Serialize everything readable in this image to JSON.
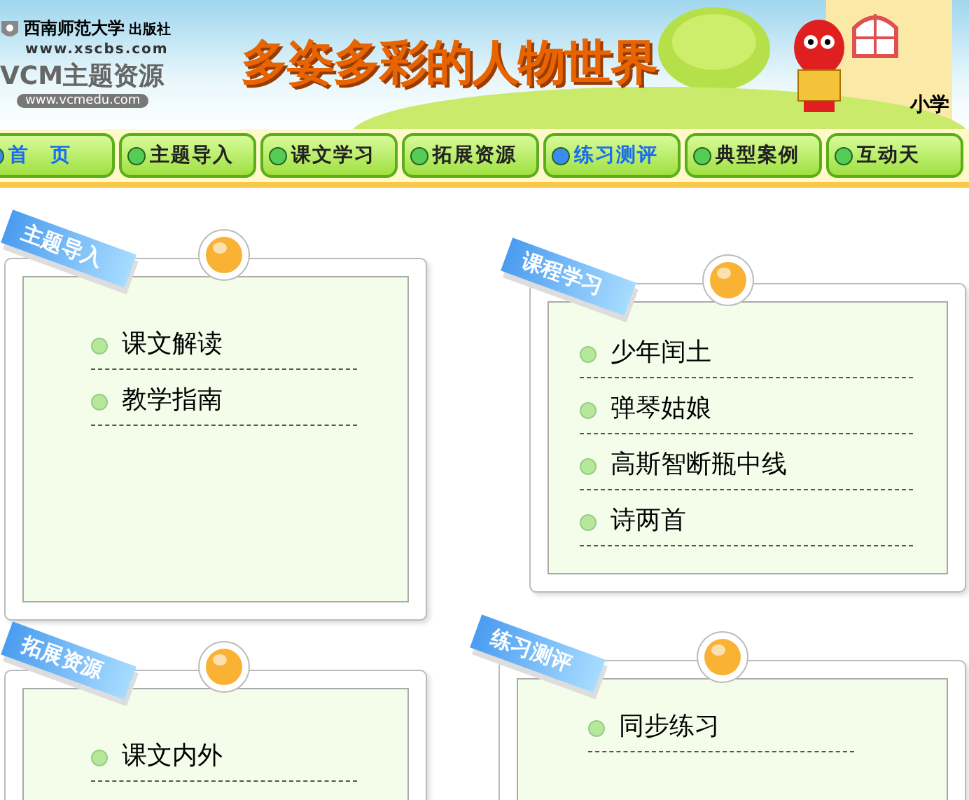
{
  "header": {
    "publisher": "西南师范大学",
    "publisher_suffix": "出版社",
    "publisher_url": "www.xscbs.com",
    "brand": "VCM主题资源",
    "brand_url": "www.vcmedu.com",
    "title": "多姿多彩的人物世界",
    "corner_label": "小学"
  },
  "nav": [
    {
      "label": "首　页",
      "selected": true
    },
    {
      "label": "主题导入",
      "selected": false
    },
    {
      "label": "课文学习",
      "selected": false
    },
    {
      "label": "拓展资源",
      "selected": false
    },
    {
      "label": "练习测评",
      "selected": true
    },
    {
      "label": "典型案例",
      "selected": false
    },
    {
      "label": "互动天",
      "selected": false
    }
  ],
  "cards": [
    {
      "ribbon": "主题导入",
      "items": [
        "课文解读",
        "教学指南"
      ]
    },
    {
      "ribbon": "课程学习",
      "items": [
        "少年闰土",
        "弹琴姑娘",
        "高斯智断瓶中线",
        "诗两首"
      ]
    },
    {
      "ribbon": "拓展资源",
      "items": [
        "课文内外"
      ]
    },
    {
      "ribbon": "练习测评",
      "items": [
        "同步练习"
      ]
    }
  ]
}
